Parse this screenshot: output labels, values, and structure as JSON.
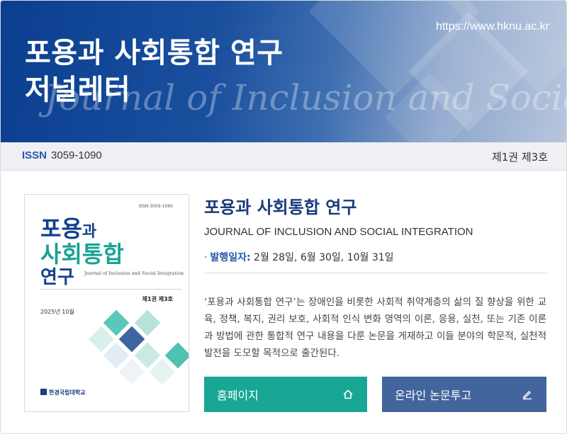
{
  "banner": {
    "url": "https://www.hknu.ac.kr",
    "title_line1": "포용과 사회통합 연구",
    "title_line2": "저널레터",
    "script_text": "Journal of Inclusion and Social Integra"
  },
  "issn_bar": {
    "issn_label": "ISSN",
    "issn_value": "3059-1090",
    "volume": "제1권 제3호"
  },
  "cover": {
    "issn": "ISSN 3059-1090",
    "title_a": "포용",
    "title_a_small": "과",
    "title_b": "사회통합",
    "title_c": "연구",
    "subtitle": "Journal of Inclusion and Social Integration",
    "volume": "제1권 제3호",
    "date": "2025년 10월",
    "publisher": "한경국립대학교",
    "colors": {
      "navy": "#12408e",
      "teal": "#19a393"
    }
  },
  "journal": {
    "title_ko": "포용과 사회통합 연구",
    "title_en": "JOURNAL OF INCLUSION AND SOCIAL INTEGRATION",
    "pub_label": "발행일자:",
    "pub_dates": "2월 28일, 6월 30일, 10월 31일",
    "description": "‘포용과 사회통합 연구’는 장애인을 비롯한 사회적 취약계층의 삶의 질 향상을 위한 교육, 정책, 복지, 권리 보호, 사회적 인식 변화 영역의 이론, 응용, 실천, 또는 기존 이론과 방법에 관한 통합적 연구 내용을 다룬 논문을 게재하고 이들 분야의 학문적, 실천적 발전을 도모할 목적으로 출간된다."
  },
  "buttons": {
    "home_label": "홈페이지",
    "home_icon": "home-icon",
    "submit_label": "온라인 논문투고",
    "submit_icon": "pencil-icon",
    "colors": {
      "home": "#19a795",
      "submit": "#43659d"
    }
  }
}
